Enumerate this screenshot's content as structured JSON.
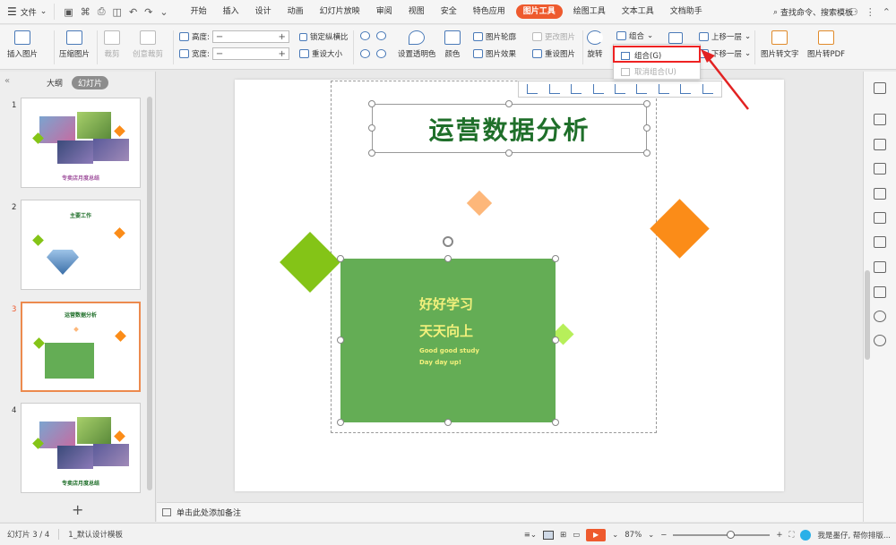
{
  "menubar": {
    "file_label": "文件",
    "tabs": [
      "开始",
      "插入",
      "设计",
      "动画",
      "幻灯片放映",
      "审阅",
      "视图",
      "安全",
      "特色应用",
      "图片工具",
      "绘图工具",
      "文本工具",
      "文档助手"
    ],
    "active_tab": "图片工具",
    "search_label": "查找命令、搜索模板"
  },
  "ribbon": {
    "insert_picture": "插入图片",
    "compress_picture": "压缩图片",
    "crop": "裁剪",
    "creative_crop": "创意裁剪",
    "height_label": "高度:",
    "width_label": "宽度:",
    "lock_ratio": "锁定纵横比",
    "reset_size": "重设大小",
    "set_transparent": "设置透明色",
    "color": "颜色",
    "picture_outline": "图片轮廓",
    "picture_effect": "图片效果",
    "change_picture": "更改图片",
    "reset_picture": "重设图片",
    "rotate": "旋转",
    "combine": "组合",
    "bring_forward": "上移一层",
    "send_backward": "下移一层",
    "pic_to_text": "图片转文字",
    "pic_to_pdf": "图片转PDF"
  },
  "dropdown": {
    "items": [
      {
        "label": "组合(G)",
        "enabled": true
      },
      {
        "label": "取消组合(U)",
        "enabled": false
      }
    ]
  },
  "left_panel": {
    "tab_outline": "大纲",
    "tab_slides": "幻灯片",
    "thumbnails": [
      {
        "num": "1",
        "caption": "专卖店月度总结"
      },
      {
        "num": "2",
        "caption": "主要工作"
      },
      {
        "num": "3",
        "caption": "运营数据分析"
      },
      {
        "num": "4",
        "caption": "专卖店月度总结"
      }
    ]
  },
  "slide": {
    "title": "运营数据分析",
    "green_box": {
      "line1": "好好学习",
      "line2": "天天向上",
      "line3": "Good good study",
      "line4": "Day day up!"
    }
  },
  "notes": {
    "placeholder": "单击此处添加备注"
  },
  "statusbar": {
    "slide_counter": "幻灯片 3 / 4",
    "template": "1_默认设计模板",
    "zoom": "87%",
    "zoom_level": 0.55,
    "assistant": "我是墨仔, 帮你排版..."
  },
  "colors": {
    "accent": "#ee5a2e",
    "slide_green": "#64ad55",
    "title_green": "#1f6f2a",
    "diamond_orange": "#fb8c18",
    "diamond_light_orange": "#fdb77a",
    "diamond_lime": "#84c417",
    "diamond_light_lime": "#b7ef5a",
    "annotation_red": "#e22222"
  }
}
